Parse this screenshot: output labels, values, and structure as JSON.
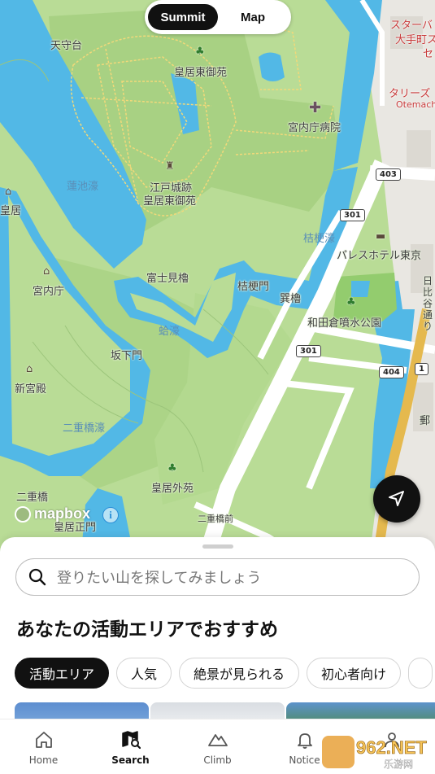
{
  "mode_toggle": {
    "summit_label": "Summit",
    "map_label": "Map",
    "active": "Summit"
  },
  "map": {
    "attribution": "mapbox",
    "labels": {
      "tenshudai": "天守台",
      "kokyo_higashi_gyoen": "皇居東御苑",
      "kunaicho_byoin": "宮内庁病院",
      "edojo_ato": "江戸城跡",
      "kokyo_higashi_gyoen_2": "皇居東御苑",
      "hasuike_bori": "蓮池濠",
      "kokyo": "皇居",
      "kunaicho": "宮内庁",
      "fujimi_yagura": "富士見櫓",
      "kikyomon": "桔梗門",
      "kikyo_bori": "桔梗濠",
      "tatsumi_yagura": "巽櫓",
      "hamaguri_bori": "蛤濠",
      "sakashitamon": "坂下門",
      "shinkyuden": "新宮殿",
      "nijubashi_bori": "二重橋濠",
      "kokyo_gaien": "皇居外苑",
      "nijubashi": "二重橋",
      "kokyo_seimon": "皇居正門",
      "nijubashimae": "二重橋前",
      "wadakura": "和田倉噴水公園",
      "palace_hotel": "パレスホテル東京",
      "starbucks": "スターバ",
      "otemachi_jp": "大手町ス",
      "se": "セ",
      "tullys": "タリーズ",
      "otemachi_en": "Otemach",
      "yubin": "郵",
      "hibiya_dori": "日比谷通り"
    },
    "route_shields": [
      "403",
      "301",
      "301",
      "404",
      "1"
    ]
  },
  "search": {
    "placeholder": "登りたい山を探してみましょう"
  },
  "recommend": {
    "title": "あなたの活動エリアでおすすめ",
    "chips": [
      {
        "label": "活動エリア",
        "active": true
      },
      {
        "label": "人気",
        "active": false
      },
      {
        "label": "絶景が見られる",
        "active": false
      },
      {
        "label": "初心者向け",
        "active": false
      }
    ]
  },
  "tabs": [
    {
      "label": "Home",
      "icon": "home-icon",
      "active": false
    },
    {
      "label": "Search",
      "icon": "map-search-icon",
      "active": true
    },
    {
      "label": "Climb",
      "icon": "mountain-icon",
      "active": false
    },
    {
      "label": "Notice",
      "icon": "bell-icon",
      "active": false
    },
    {
      "label": "",
      "icon": "profile-icon",
      "active": false
    }
  ],
  "watermark": {
    "text": "962.NET",
    "sub": "乐游网"
  },
  "colors": {
    "water": "#4fb7e6",
    "park": "#a9d68c",
    "dark": "#111111",
    "road": "#ffffff",
    "arterial": "#e5b94e"
  }
}
